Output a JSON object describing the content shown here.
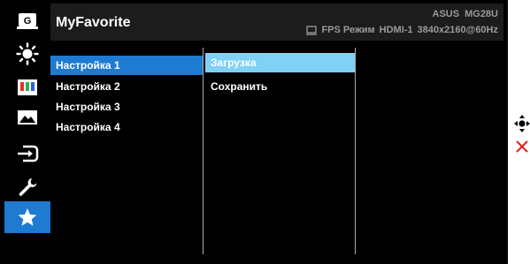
{
  "header": {
    "title": "MyFavorite",
    "brand": "ASUS",
    "model": "MG28U",
    "mode": "FPS Режим",
    "input": "HDMI-1",
    "resolution": "3840x2160@60Hz"
  },
  "sidebar": {
    "items": [
      {
        "icon": "game-visual-icon",
        "label": "G"
      },
      {
        "icon": "blue-light-filter-icon"
      },
      {
        "icon": "color-icon"
      },
      {
        "icon": "image-icon"
      },
      {
        "icon": "input-select-icon"
      },
      {
        "icon": "system-setup-icon"
      },
      {
        "icon": "favorite-star-icon",
        "active": true
      }
    ]
  },
  "menu": {
    "settings": [
      "Настройка 1",
      "Настройка 2",
      "Настройка 3",
      "Настройка 4"
    ],
    "actions": [
      "Загрузка",
      "Сохранить"
    ]
  },
  "keys": {
    "navigate_icon": "five-way-navigation-icon",
    "close_icon": "close-icon"
  },
  "colors": {
    "accent": "#1f7bd1",
    "highlight": "#7fd1f5",
    "close": "#e02020"
  }
}
